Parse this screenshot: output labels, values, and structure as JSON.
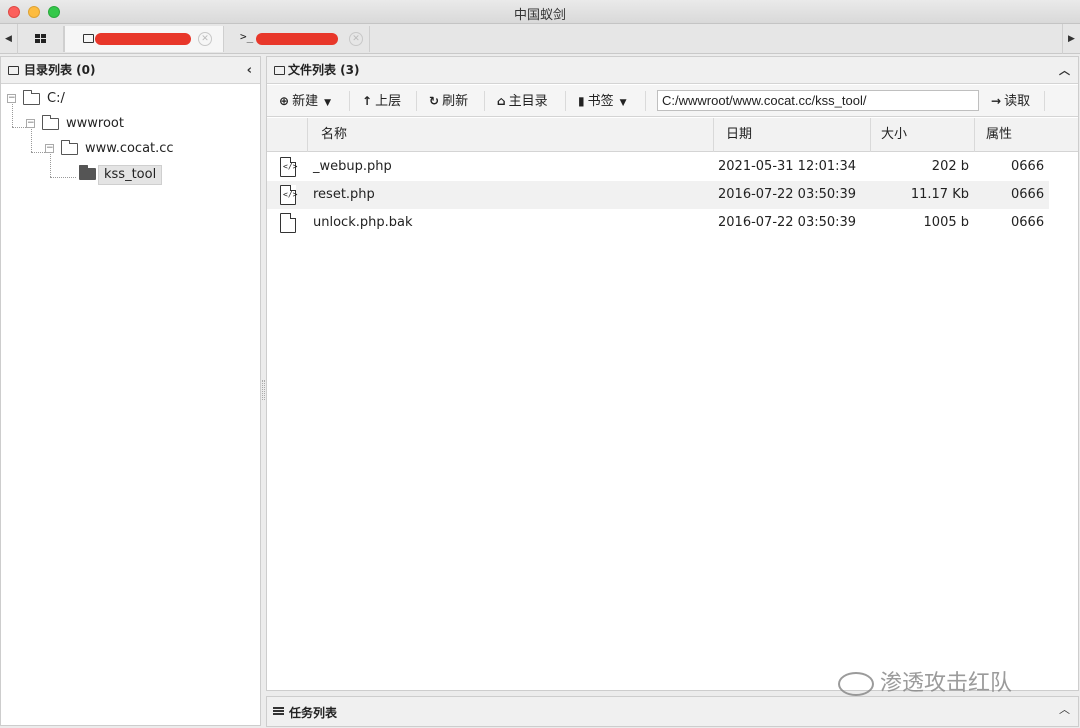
{
  "window": {
    "title": "中国蚁剑"
  },
  "tabs": [
    {
      "icon": "grid-icon"
    },
    {
      "icon": "folder-icon",
      "label_redacted": true
    },
    {
      "icon": "terminal-icon",
      "label_redacted": true
    }
  ],
  "terminal_prompt": ">_",
  "directory_panel": {
    "title": "目录列表 (0)",
    "tree": [
      {
        "label": "C:/",
        "level": 0
      },
      {
        "label": "wwwroot",
        "level": 1
      },
      {
        "label": "www.cocat.cc",
        "level": 2
      },
      {
        "label": "kss_tool",
        "level": 3,
        "selected": true
      }
    ]
  },
  "file_panel": {
    "title": "文件列表 (3)",
    "toolbar": {
      "new_label": "新建",
      "up_label": "上层",
      "refresh_label": "刷新",
      "home_label": "主目录",
      "bookmark_label": "书签",
      "path_value": "C:/wwwroot/www.cocat.cc/kss_tool/",
      "read_label": "读取"
    },
    "columns": [
      "名称",
      "日期",
      "大小",
      "属性"
    ],
    "files": [
      {
        "icon": "php-file-icon",
        "name": "_webup.php",
        "date": "2021-05-31 12:01:34",
        "size": "202 b",
        "attr": "0666"
      },
      {
        "icon": "php-file-icon",
        "name": "reset.php",
        "date": "2016-07-22 03:50:39",
        "size": "11.17 Kb",
        "attr": "0666"
      },
      {
        "icon": "file-icon",
        "name": "unlock.php.bak",
        "date": "2016-07-22 03:50:39",
        "size": "1005 b",
        "attr": "0666"
      }
    ]
  },
  "task_panel": {
    "title": "任务列表"
  },
  "watermark": {
    "text": "渗透攻击红队"
  }
}
